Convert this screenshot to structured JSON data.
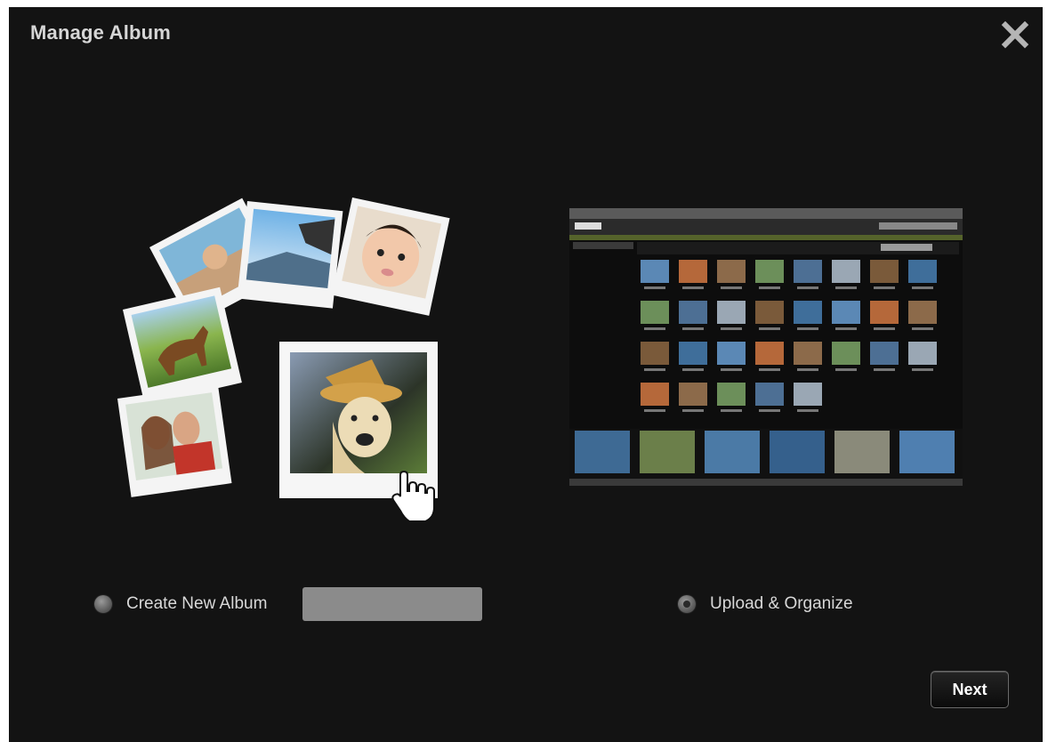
{
  "dialog": {
    "title": "Manage Album",
    "close_icon": "close-icon"
  },
  "options": {
    "create": {
      "label": "Create New Album",
      "selected": false,
      "input_value": "",
      "input_placeholder": ""
    },
    "upload": {
      "label": "Upload & Organize",
      "selected": true
    }
  },
  "actions": {
    "next_label": "Next"
  },
  "illustrations": {
    "left": "photo-stack-illustration",
    "right": "photo-manager-screenshot-preview"
  }
}
